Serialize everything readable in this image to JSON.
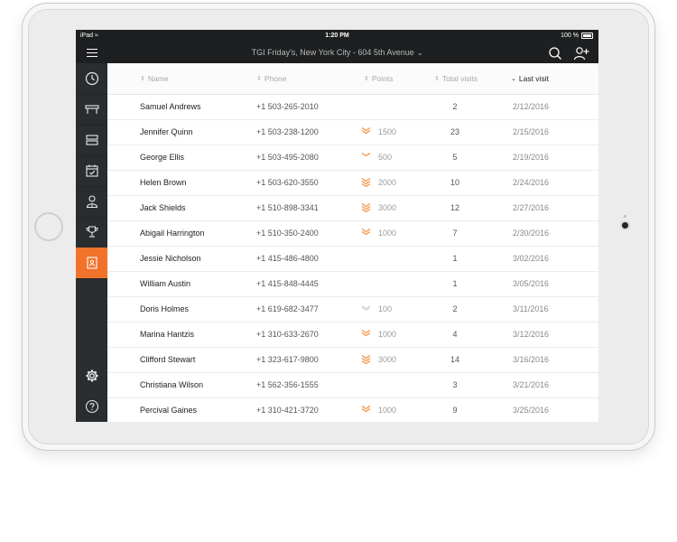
{
  "status_bar": {
    "device": "iPad",
    "time": "1:20 PM",
    "battery": "100 %"
  },
  "top_bar": {
    "venue": "TGI Friday's, New York City - 604 5th Avenue"
  },
  "sidebar": {
    "items": [
      {
        "icon": "clock-icon"
      },
      {
        "icon": "table-icon"
      },
      {
        "icon": "list-icon"
      },
      {
        "icon": "calendar-check-icon"
      },
      {
        "icon": "guest-icon"
      },
      {
        "icon": "trophy-icon"
      },
      {
        "icon": "contacts-book-icon",
        "active": true
      }
    ],
    "bottom_items": [
      {
        "icon": "gear-icon"
      },
      {
        "icon": "help-icon"
      }
    ]
  },
  "table": {
    "columns": [
      "Name",
      "Phone",
      "Points",
      "Total visits",
      "Last visit"
    ],
    "sorted_column": "Last visit",
    "rows": [
      {
        "name": "Samuel Andrews",
        "phone": "+1 503-265-2010",
        "points": "",
        "tier": "",
        "visits": "2",
        "last_visit": "2/12/2016"
      },
      {
        "name": "Jennifer Quinn",
        "phone": "+1 503-238-1200",
        "points": "1500",
        "tier": "double",
        "visits": "23",
        "last_visit": "2/15/2016"
      },
      {
        "name": "George Ellis",
        "phone": "+1 503-495-2080",
        "points": "500",
        "tier": "single",
        "visits": "5",
        "last_visit": "2/19/2016"
      },
      {
        "name": "Helen Brown",
        "phone": "+1 503-620-3550",
        "points": "2000",
        "tier": "triple",
        "visits": "10",
        "last_visit": "2/24/2016"
      },
      {
        "name": "Jack Shields",
        "phone": "+1 510-898-3341",
        "points": "3000",
        "tier": "triple",
        "visits": "12",
        "last_visit": "2/27/2016"
      },
      {
        "name": "Abigail Harrington",
        "phone": "+1 510-350-2400",
        "points": "1000",
        "tier": "double",
        "visits": "7",
        "last_visit": "2/30/2016"
      },
      {
        "name": "Jessie Nicholson",
        "phone": "+1 415-486-4800",
        "points": "",
        "tier": "",
        "visits": "1",
        "last_visit": "3/02/2016"
      },
      {
        "name": "William Austin",
        "phone": "+1 415-848-4445",
        "points": "",
        "tier": "",
        "visits": "1",
        "last_visit": "3/05/2016"
      },
      {
        "name": "Doris Holmes",
        "phone": "+1 619-682-3477",
        "points": "100",
        "tier": "basic",
        "visits": "2",
        "last_visit": "3/11/2016"
      },
      {
        "name": "Marina Hantzis",
        "phone": "+1 310-633-2670",
        "points": "1000",
        "tier": "double",
        "visits": "4",
        "last_visit": "3/12/2016"
      },
      {
        "name": "Clifford Stewart",
        "phone": "+1 323-617-9800",
        "points": "3000",
        "tier": "triple",
        "visits": "14",
        "last_visit": "3/16/2016"
      },
      {
        "name": "Christiana Wilson",
        "phone": "+1 562-356-1555",
        "points": "",
        "tier": "",
        "visits": "3",
        "last_visit": "3/21/2016"
      },
      {
        "name": "Percival Gaines",
        "phone": "+1 310-421-3720",
        "points": "1000",
        "tier": "double",
        "visits": "9",
        "last_visit": "3/25/2016"
      }
    ]
  },
  "colors": {
    "accent": "#f1722b",
    "sidebar": "#2a2d2f",
    "topbar": "#1d1f21",
    "tier_icon": "#f5a25d",
    "tier_basic": "#d9d9d9"
  }
}
